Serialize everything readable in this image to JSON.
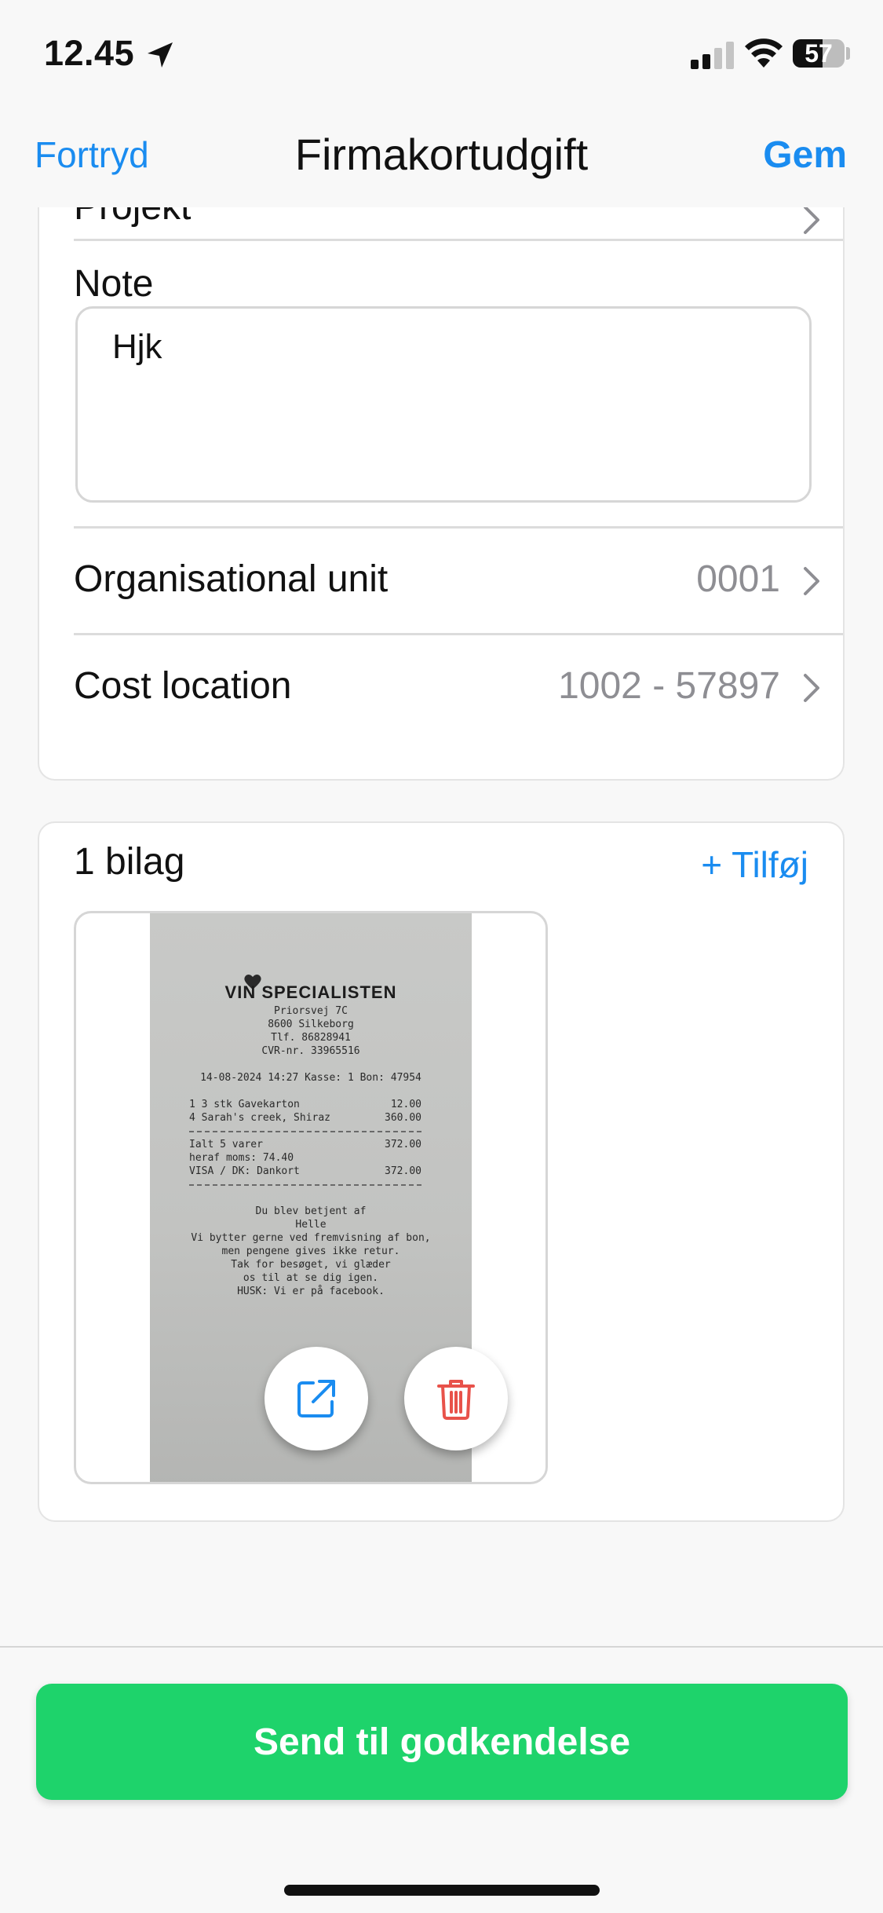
{
  "status_bar": {
    "time": "12.45",
    "battery": "57",
    "battery_level": 0.57,
    "icons": [
      "location-arrow-icon",
      "cellular-signal-icon",
      "wifi-icon",
      "battery-icon"
    ]
  },
  "nav": {
    "cancel_label": "Fortryd",
    "title": "Firmakortudgift",
    "save_label": "Gem"
  },
  "details": {
    "project_label": "Projekt",
    "note_label": "Note",
    "note_value": "Hjk",
    "org_unit_label": "Organisational unit",
    "org_unit_value": "0001",
    "cost_location_label": "Cost location",
    "cost_location_value": "1002 - 57897"
  },
  "attachments": {
    "count_label": "1 bilag",
    "add_label": "+ Tilføj",
    "action_icons": [
      "external-link-icon",
      "trash-icon"
    ]
  },
  "receipt": {
    "logo": "VIN  SPECIALISTEN",
    "lines": [
      {
        "type": "center",
        "text": "Priorsvej 7C"
      },
      {
        "type": "center",
        "text": "8600 Silkeborg"
      },
      {
        "type": "center",
        "text": "Tlf. 86828941"
      },
      {
        "type": "center",
        "text": "CVR-nr. 33965516"
      },
      {
        "type": "blank"
      },
      {
        "type": "center",
        "text": "14-08-2024 14:27  Kasse:  1   Bon:  47954"
      },
      {
        "type": "blank"
      },
      {
        "type": "pair",
        "left": "1 3 stk Gavekarton",
        "right": "12.00"
      },
      {
        "type": "pair",
        "left": "4 Sarah's creek, Shiraz",
        "right": "360.00"
      },
      {
        "type": "dash"
      },
      {
        "type": "pair",
        "left": "Ialt 5 varer",
        "right": "372.00"
      },
      {
        "type": "pair",
        "left": "  heraf moms: 74.40",
        "right": ""
      },
      {
        "type": "pair",
        "left": "VISA / DK: Dankort",
        "right": "372.00"
      },
      {
        "type": "dash"
      },
      {
        "type": "blank"
      },
      {
        "type": "center",
        "text": "Du blev betjent af"
      },
      {
        "type": "center",
        "text": "Helle"
      },
      {
        "type": "center",
        "text": "Vi bytter gerne ved fremvisning af bon,"
      },
      {
        "type": "center",
        "text": "men pengene gives ikke retur."
      },
      {
        "type": "center",
        "text": "Tak for besøget, vi glæder"
      },
      {
        "type": "center",
        "text": "os til at se dig igen."
      },
      {
        "type": "center",
        "text": "HUSK: Vi er på facebook."
      }
    ]
  },
  "footer": {
    "submit_label": "Send til godkendelse"
  },
  "colors": {
    "accent": "#1a8cf0",
    "submit": "#1ed36b",
    "delete": "#e8524a",
    "secondary_text": "#8e8e93"
  }
}
